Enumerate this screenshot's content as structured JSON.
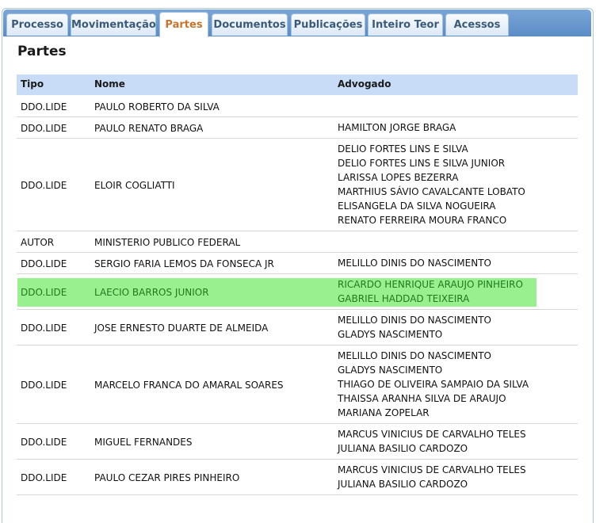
{
  "tabs": [
    {
      "label": "Processo"
    },
    {
      "label": "Movimentação"
    },
    {
      "label": "Partes",
      "active": true
    },
    {
      "label": "Documentos"
    },
    {
      "label": "Publicações"
    },
    {
      "label": "Inteiro Teor"
    },
    {
      "label": "Acessos"
    }
  ],
  "section_title": "Partes",
  "table": {
    "headers": {
      "tipo": "Tipo",
      "nome": "Nome",
      "advogado": "Advogado"
    },
    "rows": [
      {
        "tipo": "DDO.LIDE",
        "nome": "PAULO ROBERTO DA SILVA",
        "advogados": []
      },
      {
        "tipo": "DDO.LIDE",
        "nome": "PAULO RENATO BRAGA",
        "advogados": [
          "HAMILTON JORGE BRAGA"
        ]
      },
      {
        "tipo": "DDO.LIDE",
        "nome": "ELOIR COGLIATTI",
        "advogados": [
          "DELIO FORTES LINS E SILVA",
          "DELIO FORTES LINS E SILVA JUNIOR",
          "LARISSA LOPES BEZERRA",
          "MARTHIUS SÁVIO CAVALCANTE LOBATO",
          "ELISANGELA DA SILVA NOGUEIRA",
          "RENATO FERREIRA MOURA FRANCO"
        ]
      },
      {
        "tipo": "AUTOR",
        "nome": "MINISTERIO PUBLICO FEDERAL",
        "advogados": []
      },
      {
        "tipo": "DDO.LIDE",
        "nome": "SERGIO FARIA LEMOS DA FONSECA JR",
        "advogados": [
          "MELILLO DINIS DO NASCIMENTO"
        ]
      },
      {
        "tipo": "DDO.LIDE",
        "nome": "LAECIO BARROS JUNIOR",
        "advogados": [
          "RICARDO HENRIQUE ARAUJO PINHEIRO",
          "GABRIEL HADDAD TEIXEIRA"
        ],
        "highlighted": true
      },
      {
        "tipo": "DDO.LIDE",
        "nome": "JOSE ERNESTO DUARTE DE ALMEIDA",
        "advogados": [
          "MELILLO DINIS DO NASCIMENTO",
          "GLADYS NASCIMENTO"
        ]
      },
      {
        "tipo": "DDO.LIDE",
        "nome": "MARCELO FRANCA DO AMARAL SOARES",
        "advogados": [
          "MELILLO DINIS DO NASCIMENTO",
          "GLADYS NASCIMENTO",
          "THIAGO DE OLIVEIRA SAMPAIO DA SILVA",
          "THAISSA ARANHA SILVA DE ARAUJO",
          "MARIANA ZOPELAR"
        ]
      },
      {
        "tipo": "DDO.LIDE",
        "nome": "MIGUEL FERNANDES",
        "advogados": [
          "MARCUS VINICIUS DE CARVALHO TELES",
          "JULIANA BASILIO CARDOZO"
        ]
      },
      {
        "tipo": "DDO.LIDE",
        "nome": "PAULO CEZAR PIRES PINHEIRO",
        "advogados": [
          "MARCUS VINICIUS DE CARVALHO TELES",
          "JULIANA BASILIO CARDOZO"
        ]
      }
    ]
  },
  "colors": {
    "highlight": "#99f08e",
    "header_bg": "#c8dcf7",
    "active_tab_text": "#c8742c"
  }
}
